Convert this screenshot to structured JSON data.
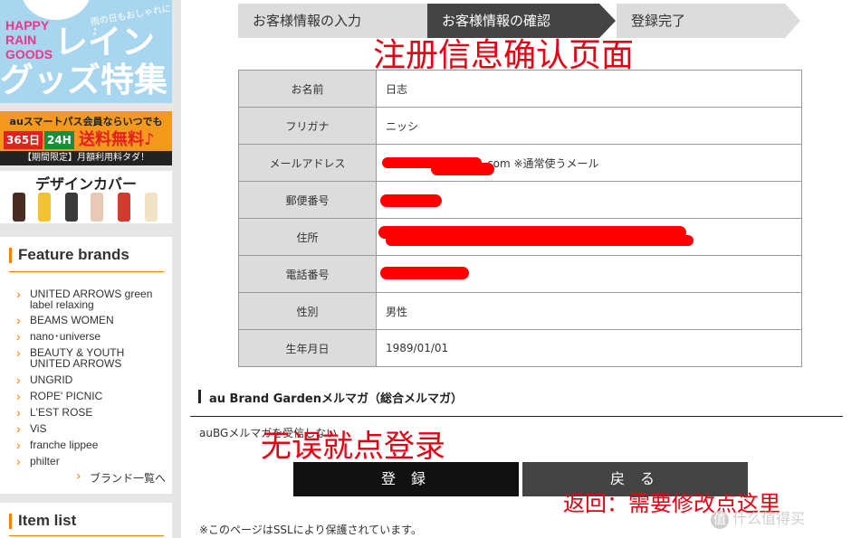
{
  "sidebar": {
    "banner_rain": {
      "line1": "HAPPY",
      "line2": "RAIN",
      "line3": "GOODS",
      "small": "雨の日もおしゃれに♪",
      "big1": "レイン",
      "big2": "グッズ特集"
    },
    "banner_pass": {
      "line1": "auスマートパス会員ならいつでも",
      "badge1": "365日",
      "badge2": "24H",
      "free": "送料無料♪",
      "line3": "【期間限定】月額利用料タダ！"
    },
    "banner_cover": {
      "title": "デザインカバー"
    },
    "feature": {
      "title": "Feature brands",
      "brands": [
        "UNITED ARROWS green label relaxing",
        "BEAMS WOMEN",
        "nano･universe",
        "BEAUTY & YOUTH UNITED ARROWS",
        "UNGRID",
        "ROPE' PICNIC",
        "L'EST ROSE",
        "ViS",
        "franche lippee",
        "philter"
      ],
      "all_link": "ブランド一覧へ"
    },
    "item_list": {
      "title": "Item list"
    }
  },
  "steps": {
    "step1": "お客様情報の入力",
    "step2": "お客様情報の確認",
    "step3": "登録完了"
  },
  "annotations": {
    "top": "注册信息确认页面",
    "middle": "无误就点登录",
    "bottom": "返回：需要修改点这里"
  },
  "table": {
    "rows": [
      {
        "label": "お名前",
        "value": "日志"
      },
      {
        "label": "フリガナ",
        "value": "ニッシ"
      },
      {
        "label": "メールアドレス",
        "value": "com ※通常使うメール"
      },
      {
        "label": "郵便番号",
        "value": ""
      },
      {
        "label": "住所",
        "value": ""
      },
      {
        "label": "電話番号",
        "value": ""
      },
      {
        "label": "性別",
        "value": "男性"
      },
      {
        "label": "生年月日",
        "value": "1989/01/01"
      }
    ]
  },
  "mailmag": {
    "title": "au Brand Gardenメルマガ（総合メルマガ）",
    "text": "auBGメルマガを受信しない"
  },
  "buttons": {
    "register": "登 録",
    "back": "戻 る"
  },
  "ssl_note": "※このページはSSLにより保護されています。",
  "watermark": "什么值得买",
  "colors": {
    "accent": "#f08300",
    "annotation_red": "#e60012",
    "step_active": "#444444",
    "step_inactive": "#dcdcdc"
  }
}
